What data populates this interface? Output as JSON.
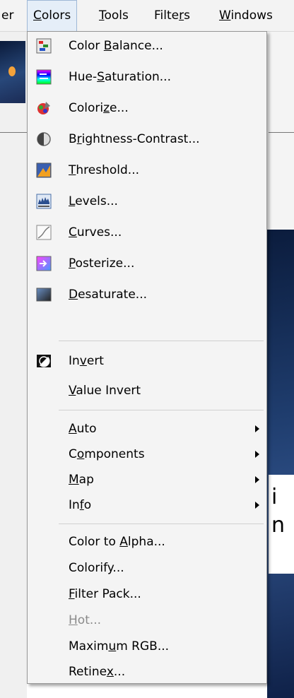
{
  "menubar": {
    "items": [
      {
        "label": "er"
      },
      {
        "label": "Colors",
        "u": "C",
        "rest": "olors"
      },
      {
        "label": "Tools",
        "u": "T",
        "rest": "ools"
      },
      {
        "label": "Filters",
        "pre": "Filte",
        "u": "r",
        "rest": "s"
      },
      {
        "label": "Windows",
        "u": "W",
        "rest": "indows"
      }
    ]
  },
  "menu": {
    "items": [
      {
        "icon": "color-balance-icon",
        "pre": "Color ",
        "u": "B",
        "post": "alance..."
      },
      {
        "icon": "hue-saturation-icon",
        "pre": "Hue-",
        "u": "S",
        "post": "aturation..."
      },
      {
        "icon": "colorize-icon",
        "pre": "Colori",
        "u": "z",
        "post": "e..."
      },
      {
        "icon": "brightness-contrast-icon",
        "pre": "B",
        "u": "r",
        "post": "ightness-Contrast..."
      },
      {
        "icon": "threshold-icon",
        "pre": "",
        "u": "T",
        "post": "hreshold..."
      },
      {
        "icon": "levels-icon",
        "pre": "",
        "u": "L",
        "post": "evels..."
      },
      {
        "icon": "curves-icon",
        "pre": "",
        "u": "C",
        "post": "urves..."
      },
      {
        "icon": "posterize-icon",
        "pre": "",
        "u": "P",
        "post": "osterize..."
      },
      {
        "icon": "desaturate-icon",
        "pre": "",
        "u": "D",
        "post": "esaturate..."
      },
      {
        "icon": "invert-icon",
        "pre": "In",
        "u": "v",
        "post": "ert"
      },
      {
        "pre": "",
        "u": "V",
        "post": "alue Invert"
      },
      {
        "pre": "",
        "u": "A",
        "post": "uto"
      },
      {
        "pre": "C",
        "u": "o",
        "post": "mponents"
      },
      {
        "pre": "",
        "u": "M",
        "post": "ap"
      },
      {
        "pre": "In",
        "u": "f",
        "post": "o"
      },
      {
        "pre": "Color to ",
        "u": "A",
        "post": "lpha..."
      },
      {
        "pre": "Colorify...",
        "u": "",
        "post": ""
      },
      {
        "pre": "",
        "u": "F",
        "post": "ilter Pack..."
      },
      {
        "pre": "",
        "u": "H",
        "post": "ot..."
      },
      {
        "pre": "Maxim",
        "u": "u",
        "post": "m RGB..."
      },
      {
        "pre": "Retine",
        "u": "x",
        "post": "..."
      }
    ]
  },
  "background": {
    "panel_text_1": "i",
    "panel_text_2": "n"
  }
}
